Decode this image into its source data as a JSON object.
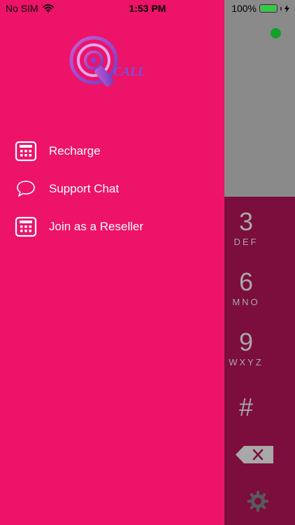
{
  "status_bar": {
    "carrier": "No SIM",
    "time": "1:53 PM",
    "battery_level": "100%",
    "battery_fraction": 1.0
  },
  "drawer": {
    "logo_text": "CALL",
    "menu_items": [
      {
        "label": "Recharge",
        "icon": "calculator-icon"
      },
      {
        "label": "Support Chat",
        "icon": "chat-bubble-icon"
      },
      {
        "label": "Join as a Reseller",
        "icon": "calculator-icon"
      }
    ]
  },
  "dialer": {
    "keys": [
      {
        "digit": "3",
        "letters": "DEF"
      },
      {
        "digit": "6",
        "letters": "MNO"
      },
      {
        "digit": "9",
        "letters": "WXYZ"
      },
      {
        "digit": "#",
        "letters": ""
      }
    ]
  },
  "colors": {
    "drawer": "#ec1369",
    "dialer_pad": "#7b0e3c",
    "dialer_top": "#8a8a8a",
    "online": "#14a02a"
  }
}
